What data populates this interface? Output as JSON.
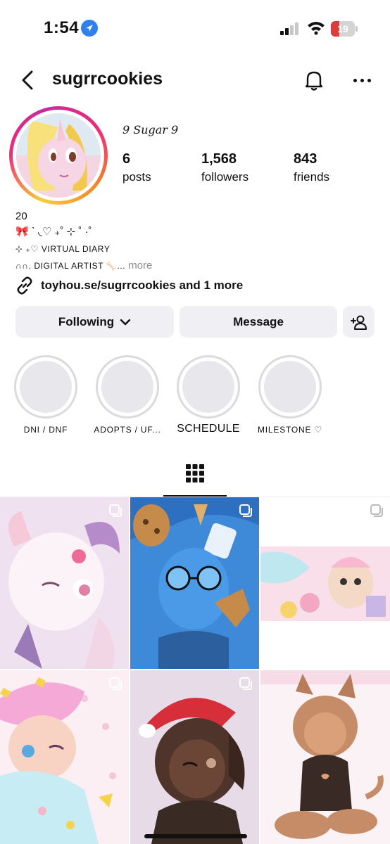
{
  "status_bar": {
    "time": "1:54",
    "battery": "19"
  },
  "header": {
    "username": "sugrrcookies"
  },
  "profile": {
    "display_name": "9 Sugar 9",
    "stats": [
      {
        "count": "6",
        "label": "posts"
      },
      {
        "count": "1,568",
        "label": "followers"
      },
      {
        "count": "843",
        "label": "friends"
      }
    ],
    "bio": {
      "line1": "20",
      "line2": "🎀 ˋ ◟♡ ₊˚ ⊹ ˚ ·˚",
      "line3": "⊹ ₊♡ VIRTUAL DIARY",
      "line4": "∩∩. DIGITAL ARTIST 🦴...",
      "more": "more"
    },
    "link": "toyhou.se/sugrrcookies and 1 more"
  },
  "actions": {
    "following": "Following",
    "message": "Message"
  },
  "highlights": [
    {
      "label": "DNI / DNF"
    },
    {
      "label": "ADOPTS / UF..."
    },
    {
      "label": "SCHEDULE"
    },
    {
      "label": "MILESTONE ♡"
    }
  ],
  "colors": {
    "accent_blue": "#2f80ed",
    "battery_low": "#e03b3b",
    "button_bg": "#efeff4",
    "muted_text": "#8e8e8e"
  },
  "posts": [
    {
      "alt_icon": "multi-post-icon"
    },
    {
      "alt_icon": "multi-post-icon"
    },
    {
      "alt_icon": "multi-post-icon"
    },
    {
      "alt_icon": "multi-post-icon"
    },
    {
      "alt_icon": "multi-post-icon"
    },
    {
      "alt_icon": "none"
    }
  ]
}
